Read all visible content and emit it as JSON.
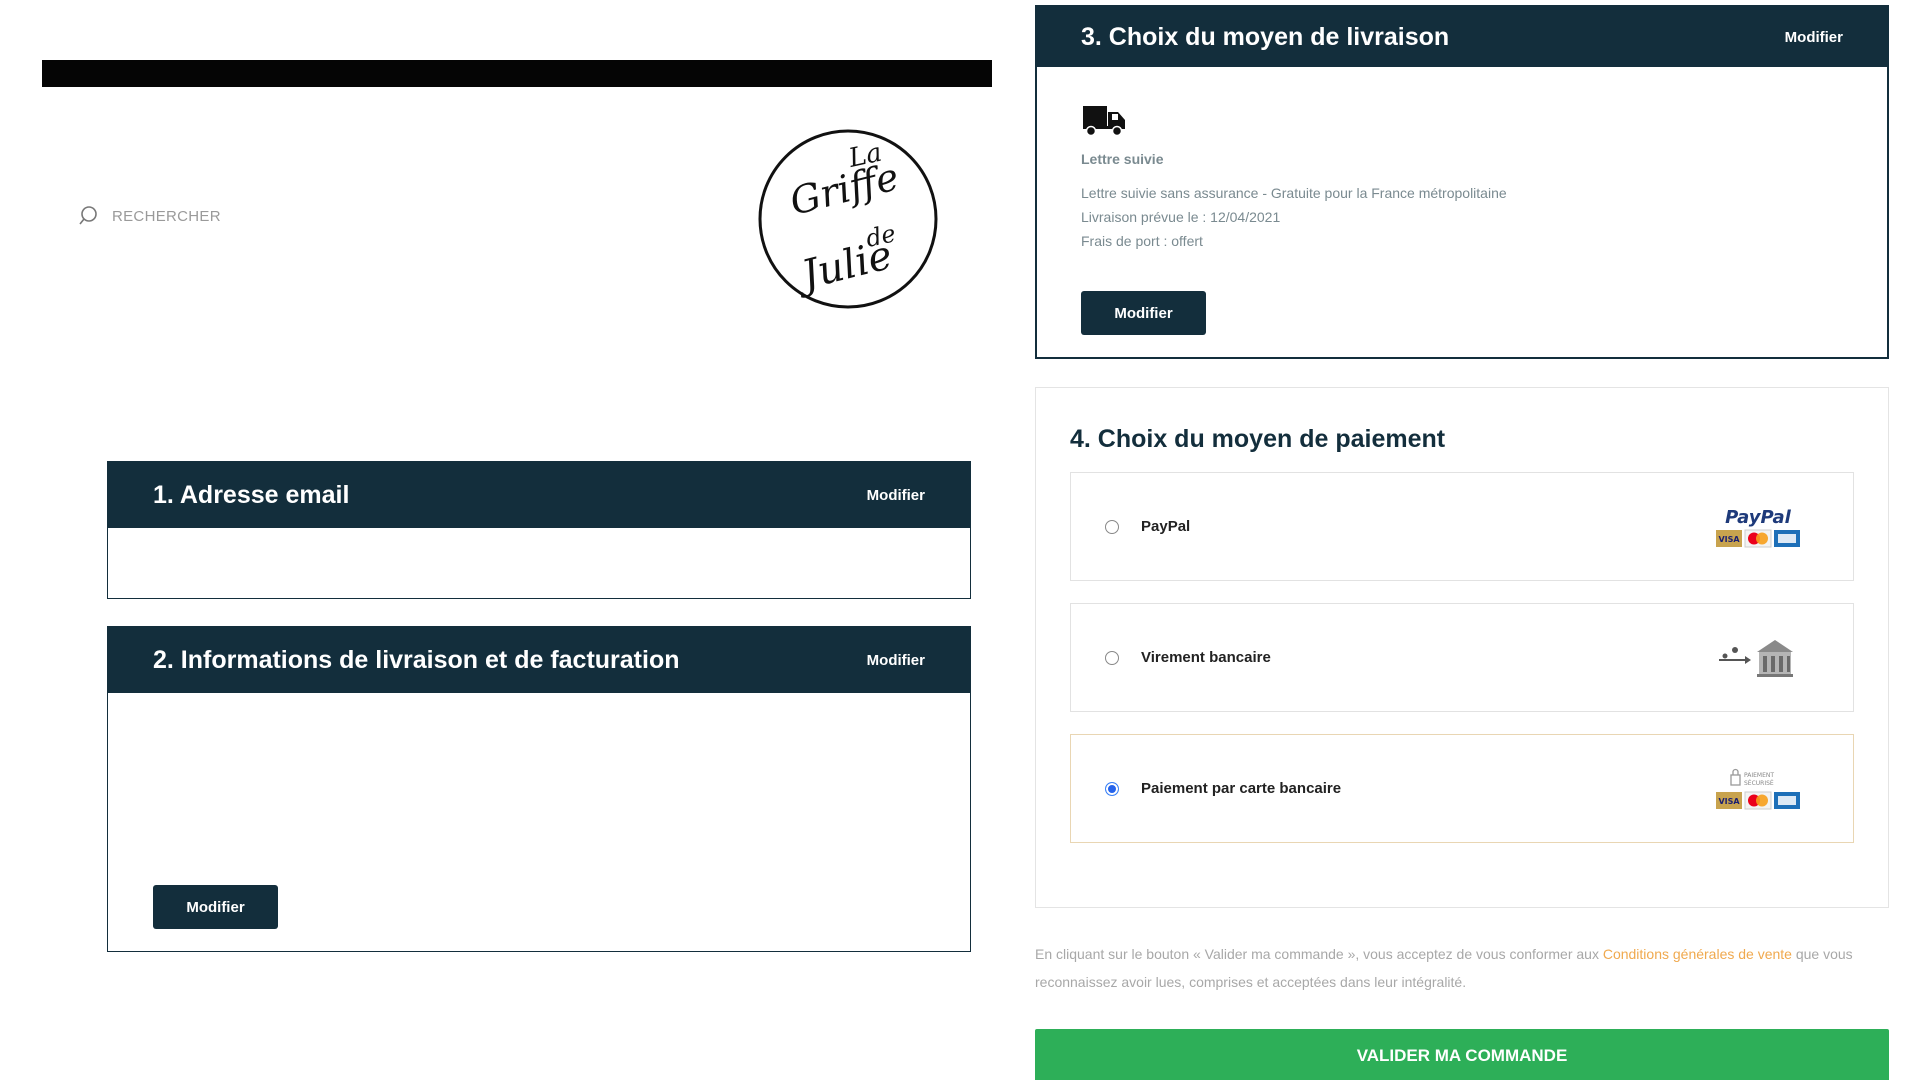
{
  "search": {
    "label": "RECHERCHER"
  },
  "logo": {
    "line1": "La",
    "line2": "Griffe",
    "line3": "de",
    "line4": "Julie"
  },
  "steps": {
    "email": {
      "title": "1. Adresse email",
      "action": "Modifier"
    },
    "info": {
      "title": "2. Informations de livraison et de facturation",
      "action": "Modifier",
      "button": "Modifier"
    },
    "delivery": {
      "title": "3. Choix du moyen de livraison",
      "action": "Modifier",
      "method_name": "Lettre suivie",
      "description": "Lettre suivie sans assurance - Gratuite pour la France métropolitaine",
      "date": "Livraison prévue le : 12/04/2021",
      "shipping": "Frais de port : offert",
      "button": "Modifier"
    },
    "payment": {
      "title": "4. Choix du moyen de paiement",
      "options": [
        {
          "label": "PayPal",
          "selected": false,
          "logo_text": "PayPal"
        },
        {
          "label": "Virement bancaire",
          "selected": false
        },
        {
          "label": "Paiement par carte bancaire",
          "selected": true,
          "logo_text_1": "PAIEMENT",
          "logo_text_2": "SÉCURISÉ"
        }
      ]
    }
  },
  "terms": {
    "before": "En cliquant sur le bouton « Valider ma commande », vous acceptez de vous conformer aux ",
    "link": "Conditions générales de vente",
    "after": " que vous reconnaissez avoir lues, comprises et acceptées dans leur intégralité."
  },
  "submit_label": "VALIDER MA COMMANDE",
  "colors": {
    "header": "#132e3c",
    "submit": "#2daf58",
    "link": "#f0a94e",
    "radio_selected": "#2563eb"
  },
  "card_logos": {
    "visa": "VISA"
  }
}
